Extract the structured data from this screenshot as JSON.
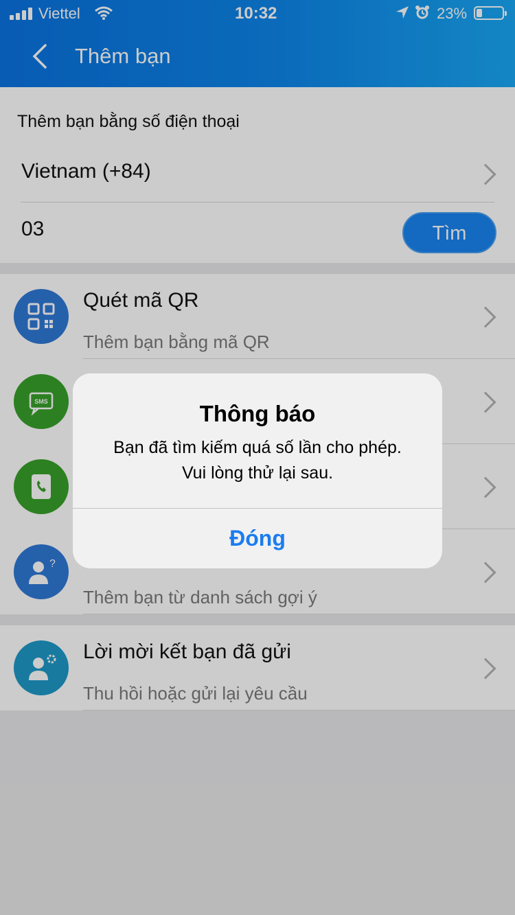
{
  "status_bar": {
    "carrier": "Viettel",
    "time": "10:32",
    "battery": "23%"
  },
  "header": {
    "title": "Thêm bạn"
  },
  "phone_search": {
    "section_label": "Thêm bạn bằng số điện thoại",
    "country": "Vietnam (+84)",
    "phone_value": "03",
    "find_label": "Tìm"
  },
  "list": {
    "items": [
      {
        "title": "Quét mã QR",
        "subtitle": "Thêm bạn bằng mã QR",
        "icon": "qr-code-icon",
        "color": "#2f78d6"
      },
      {
        "title": "",
        "subtitle": "",
        "icon": "sms-icon",
        "color": "#37a12a"
      },
      {
        "title": "",
        "subtitle": "",
        "icon": "phonebook-icon",
        "color": "#37a12a"
      },
      {
        "title": "",
        "subtitle": "Thêm bạn từ danh sách gợi ý",
        "icon": "suggest-user-icon",
        "color": "#2f78d6"
      },
      {
        "title": "Lời mời kết bạn đã gửi",
        "subtitle": "Thu hồi hoặc gửi lại yêu cầu",
        "icon": "sent-request-icon",
        "color": "#1f99c7"
      }
    ]
  },
  "alert": {
    "title": "Thông báo",
    "message_line1": "Bạn đã tìm kiếm quá số lần cho phép.",
    "message_line2": "Vui lòng thử lại sau.",
    "button": "Đóng"
  },
  "colors": {
    "header_start": "#0a73e0",
    "header_end": "#19a8f5",
    "accent": "#1b7cf0"
  }
}
